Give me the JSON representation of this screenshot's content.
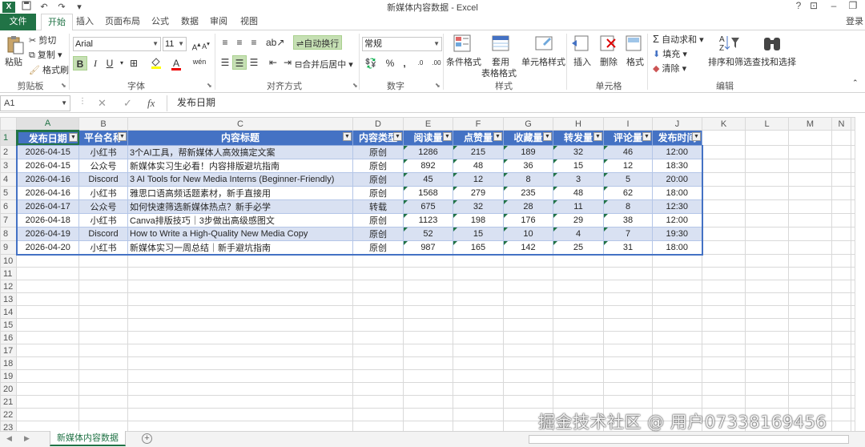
{
  "window": {
    "title": "新媒体内容数据 - Excel",
    "app_icon": "X",
    "help": "?",
    "login": "登录"
  },
  "tabs": [
    "文件",
    "开始",
    "插入",
    "页面布局",
    "公式",
    "数据",
    "审阅",
    "视图"
  ],
  "ribbon": {
    "clipboard": {
      "paste": "粘贴",
      "cut": "剪切",
      "copy": "复制",
      "format_painter": "格式刷",
      "label": "剪贴板"
    },
    "font": {
      "name": "Arial",
      "size": "11",
      "bold": "B",
      "italic": "I",
      "underline": "U",
      "label": "字体"
    },
    "alignment": {
      "wrap": "自动换行",
      "merge": "合并后居中",
      "label": "对齐方式"
    },
    "number": {
      "format": "常规",
      "percent": "%",
      "comma": ",",
      "inc_dec": ".0",
      "dec_dec": ".00",
      "label": "数字"
    },
    "styles": {
      "conditional": "条件格式",
      "table": "套用",
      "table2": "表格格式",
      "cell_styles": "单元格样式",
      "label": "样式"
    },
    "cells": {
      "insert": "插入",
      "delete": "删除",
      "format": "格式",
      "label": "单元格"
    },
    "editing": {
      "autosum": "自动求和",
      "fill": "填充",
      "clear": "清除",
      "sort": "排序和筛选",
      "find": "查找和选择",
      "label": "编辑"
    }
  },
  "formula_bar": {
    "name_box": "A1",
    "cancel": "✕",
    "enter": "✓",
    "fx": "fx",
    "content": "发布日期"
  },
  "columns": [
    "A",
    "B",
    "C",
    "D",
    "E",
    "F",
    "G",
    "H",
    "I",
    "J",
    "K",
    "L",
    "M",
    "N"
  ],
  "table": {
    "headers": [
      "发布日期",
      "平台名称",
      "内容标题",
      "内容类型",
      "阅读量",
      "点赞量",
      "收藏量",
      "转发量",
      "评论量",
      "发布时间"
    ],
    "rows": [
      [
        "2026-04-15",
        "小红书",
        "3个AI工具，帮新媒体人高效搞定文案",
        "原创",
        "1286",
        "215",
        "189",
        "32",
        "46",
        "12:00"
      ],
      [
        "2026-04-15",
        "公众号",
        "新媒体实习生必看！内容排版避坑指南",
        "原创",
        "892",
        "48",
        "36",
        "15",
        "12",
        "18:30"
      ],
      [
        "2026-04-16",
        "Discord",
        "3 AI Tools for New Media Interns (Beginner-Friendly)",
        "原创",
        "45",
        "12",
        "8",
        "3",
        "5",
        "20:00"
      ],
      [
        "2026-04-16",
        "小红书",
        "雅思口语高频话题素材，新手直接用",
        "原创",
        "1568",
        "279",
        "235",
        "48",
        "62",
        "18:00"
      ],
      [
        "2026-04-17",
        "公众号",
        "如何快速筛选新媒体热点？新手必学",
        "转载",
        "675",
        "32",
        "28",
        "11",
        "8",
        "12:30"
      ],
      [
        "2026-04-18",
        "小红书",
        "Canva排版技巧｜3步做出高级感图文",
        "原创",
        "1123",
        "198",
        "176",
        "29",
        "38",
        "12:00"
      ],
      [
        "2026-04-19",
        "Discord",
        "How to Write a High-Quality New Media Copy",
        "原创",
        "52",
        "15",
        "10",
        "4",
        "7",
        "19:30"
      ],
      [
        "2026-04-20",
        "小红书",
        "新媒体实习一周总结｜新手避坑指南",
        "原创",
        "987",
        "165",
        "142",
        "25",
        "31",
        "18:00"
      ]
    ]
  },
  "total_rows": 24,
  "sheet_tab": "新媒体内容数据",
  "add_sheet": "+",
  "watermark": "掘金技术社区 @ 用户07338169456"
}
